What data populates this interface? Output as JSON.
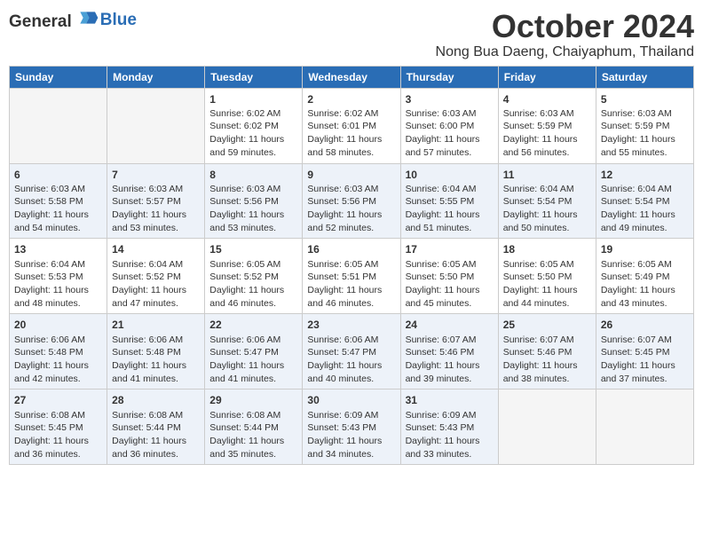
{
  "header": {
    "logo_general": "General",
    "logo_blue": "Blue",
    "month_title": "October 2024",
    "location": "Nong Bua Daeng, Chaiyaphum, Thailand"
  },
  "weekdays": [
    "Sunday",
    "Monday",
    "Tuesday",
    "Wednesday",
    "Thursday",
    "Friday",
    "Saturday"
  ],
  "weeks": [
    [
      {
        "day": "",
        "info": ""
      },
      {
        "day": "",
        "info": ""
      },
      {
        "day": "1",
        "info": "Sunrise: 6:02 AM\nSunset: 6:02 PM\nDaylight: 11 hours\nand 59 minutes."
      },
      {
        "day": "2",
        "info": "Sunrise: 6:02 AM\nSunset: 6:01 PM\nDaylight: 11 hours\nand 58 minutes."
      },
      {
        "day": "3",
        "info": "Sunrise: 6:03 AM\nSunset: 6:00 PM\nDaylight: 11 hours\nand 57 minutes."
      },
      {
        "day": "4",
        "info": "Sunrise: 6:03 AM\nSunset: 5:59 PM\nDaylight: 11 hours\nand 56 minutes."
      },
      {
        "day": "5",
        "info": "Sunrise: 6:03 AM\nSunset: 5:59 PM\nDaylight: 11 hours\nand 55 minutes."
      }
    ],
    [
      {
        "day": "6",
        "info": "Sunrise: 6:03 AM\nSunset: 5:58 PM\nDaylight: 11 hours\nand 54 minutes."
      },
      {
        "day": "7",
        "info": "Sunrise: 6:03 AM\nSunset: 5:57 PM\nDaylight: 11 hours\nand 53 minutes."
      },
      {
        "day": "8",
        "info": "Sunrise: 6:03 AM\nSunset: 5:56 PM\nDaylight: 11 hours\nand 53 minutes."
      },
      {
        "day": "9",
        "info": "Sunrise: 6:03 AM\nSunset: 5:56 PM\nDaylight: 11 hours\nand 52 minutes."
      },
      {
        "day": "10",
        "info": "Sunrise: 6:04 AM\nSunset: 5:55 PM\nDaylight: 11 hours\nand 51 minutes."
      },
      {
        "day": "11",
        "info": "Sunrise: 6:04 AM\nSunset: 5:54 PM\nDaylight: 11 hours\nand 50 minutes."
      },
      {
        "day": "12",
        "info": "Sunrise: 6:04 AM\nSunset: 5:54 PM\nDaylight: 11 hours\nand 49 minutes."
      }
    ],
    [
      {
        "day": "13",
        "info": "Sunrise: 6:04 AM\nSunset: 5:53 PM\nDaylight: 11 hours\nand 48 minutes."
      },
      {
        "day": "14",
        "info": "Sunrise: 6:04 AM\nSunset: 5:52 PM\nDaylight: 11 hours\nand 47 minutes."
      },
      {
        "day": "15",
        "info": "Sunrise: 6:05 AM\nSunset: 5:52 PM\nDaylight: 11 hours\nand 46 minutes."
      },
      {
        "day": "16",
        "info": "Sunrise: 6:05 AM\nSunset: 5:51 PM\nDaylight: 11 hours\nand 46 minutes."
      },
      {
        "day": "17",
        "info": "Sunrise: 6:05 AM\nSunset: 5:50 PM\nDaylight: 11 hours\nand 45 minutes."
      },
      {
        "day": "18",
        "info": "Sunrise: 6:05 AM\nSunset: 5:50 PM\nDaylight: 11 hours\nand 44 minutes."
      },
      {
        "day": "19",
        "info": "Sunrise: 6:05 AM\nSunset: 5:49 PM\nDaylight: 11 hours\nand 43 minutes."
      }
    ],
    [
      {
        "day": "20",
        "info": "Sunrise: 6:06 AM\nSunset: 5:48 PM\nDaylight: 11 hours\nand 42 minutes."
      },
      {
        "day": "21",
        "info": "Sunrise: 6:06 AM\nSunset: 5:48 PM\nDaylight: 11 hours\nand 41 minutes."
      },
      {
        "day": "22",
        "info": "Sunrise: 6:06 AM\nSunset: 5:47 PM\nDaylight: 11 hours\nand 41 minutes."
      },
      {
        "day": "23",
        "info": "Sunrise: 6:06 AM\nSunset: 5:47 PM\nDaylight: 11 hours\nand 40 minutes."
      },
      {
        "day": "24",
        "info": "Sunrise: 6:07 AM\nSunset: 5:46 PM\nDaylight: 11 hours\nand 39 minutes."
      },
      {
        "day": "25",
        "info": "Sunrise: 6:07 AM\nSunset: 5:46 PM\nDaylight: 11 hours\nand 38 minutes."
      },
      {
        "day": "26",
        "info": "Sunrise: 6:07 AM\nSunset: 5:45 PM\nDaylight: 11 hours\nand 37 minutes."
      }
    ],
    [
      {
        "day": "27",
        "info": "Sunrise: 6:08 AM\nSunset: 5:45 PM\nDaylight: 11 hours\nand 36 minutes."
      },
      {
        "day": "28",
        "info": "Sunrise: 6:08 AM\nSunset: 5:44 PM\nDaylight: 11 hours\nand 36 minutes."
      },
      {
        "day": "29",
        "info": "Sunrise: 6:08 AM\nSunset: 5:44 PM\nDaylight: 11 hours\nand 35 minutes."
      },
      {
        "day": "30",
        "info": "Sunrise: 6:09 AM\nSunset: 5:43 PM\nDaylight: 11 hours\nand 34 minutes."
      },
      {
        "day": "31",
        "info": "Sunrise: 6:09 AM\nSunset: 5:43 PM\nDaylight: 11 hours\nand 33 minutes."
      },
      {
        "day": "",
        "info": ""
      },
      {
        "day": "",
        "info": ""
      }
    ]
  ]
}
